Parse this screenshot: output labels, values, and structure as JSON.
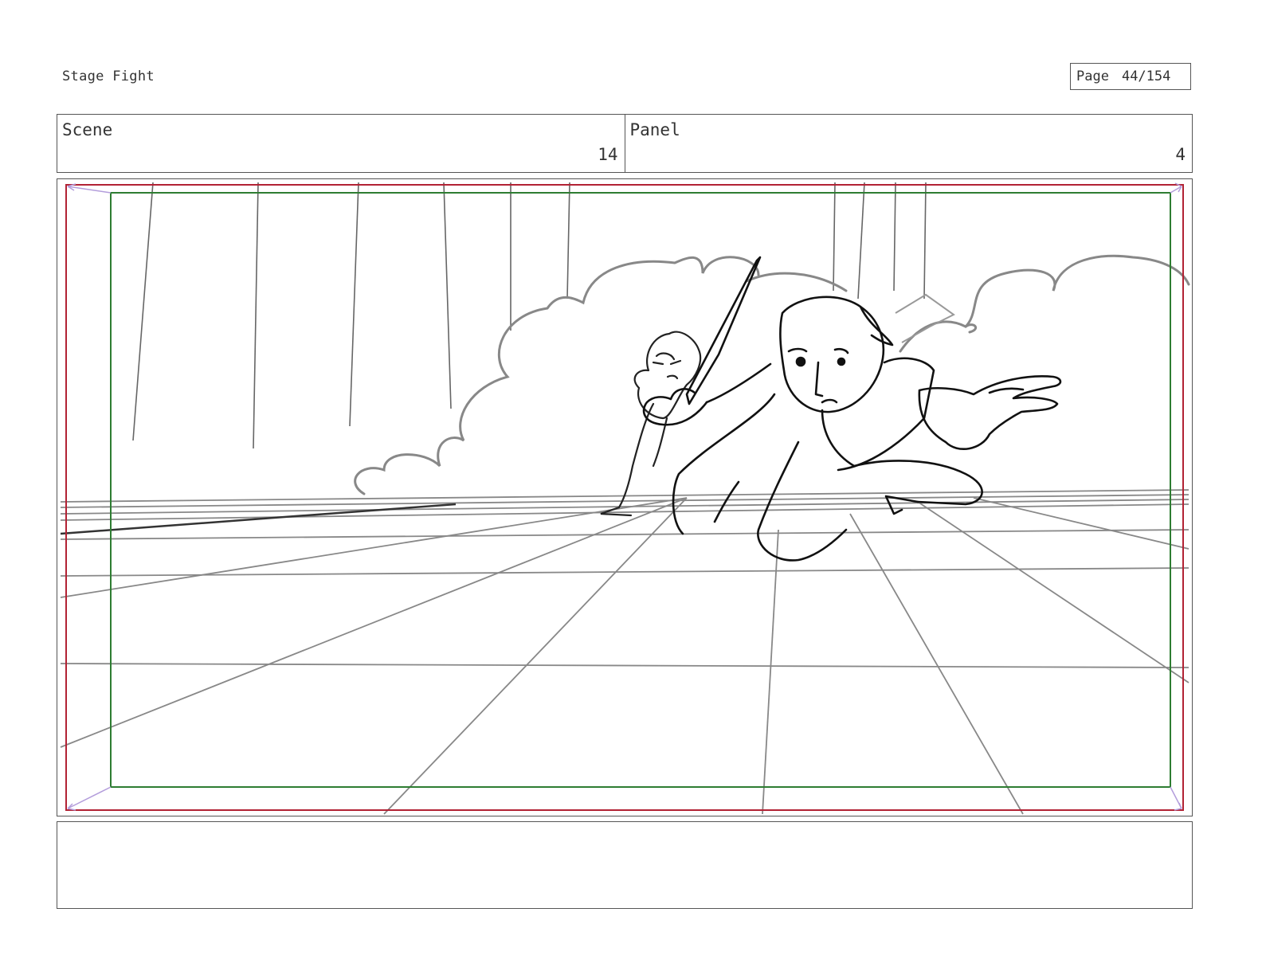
{
  "document": {
    "title": "Stage Fight"
  },
  "page": {
    "label": "Page",
    "number": "44/154"
  },
  "header": {
    "scene": {
      "label": "Scene",
      "value": "14"
    },
    "panel": {
      "label": "Panel",
      "value": "4"
    }
  },
  "frame": {
    "safe_area_color": "#b22234",
    "action_area_color": "#2e7d32",
    "corner_marker_color": "#b39ddb",
    "sketch_color": "#111111",
    "guide_color": "#888888"
  },
  "notes": {
    "text": ""
  }
}
